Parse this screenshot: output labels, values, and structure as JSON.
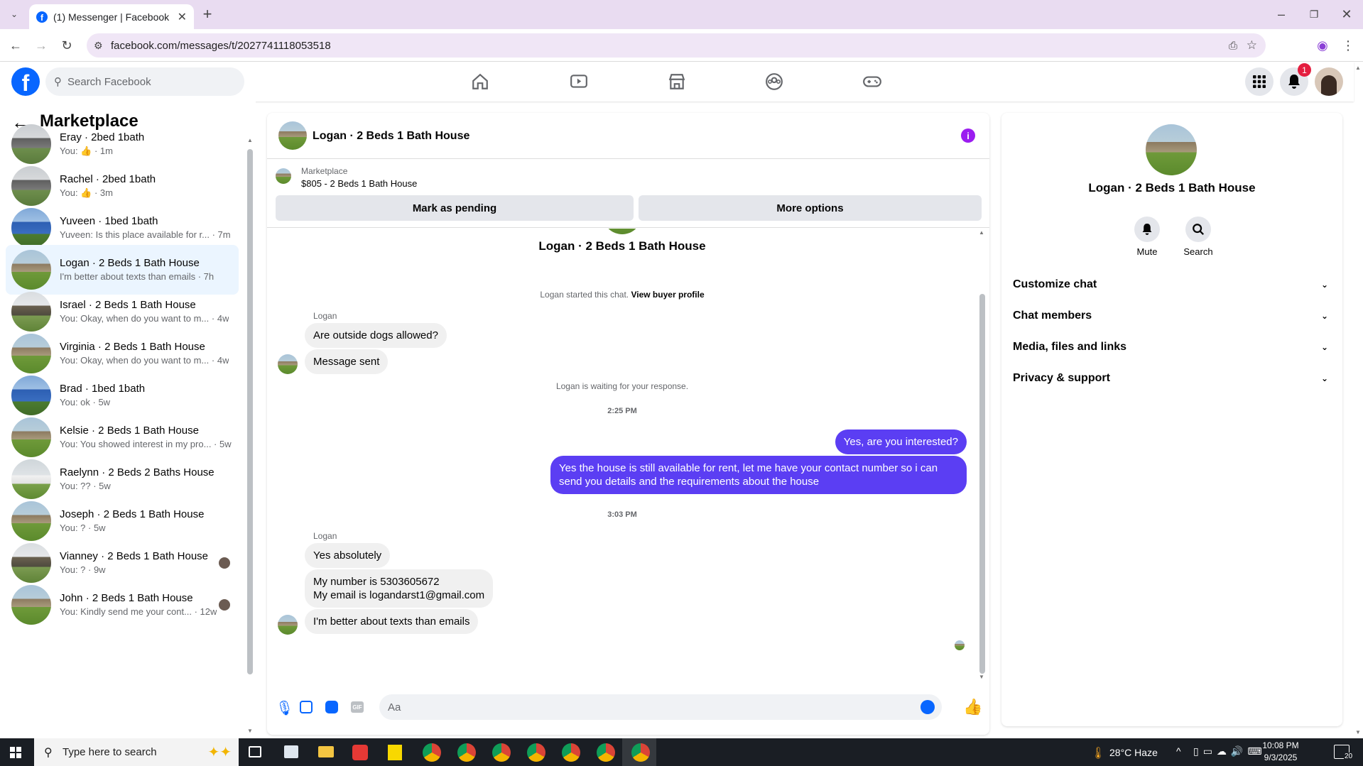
{
  "browser": {
    "tab_title": "(1) Messenger | Facebook",
    "url": "facebook.com/messages/t/2027741118053518"
  },
  "fb": {
    "search_placeholder": "Search Facebook",
    "notification_count": "1"
  },
  "sidebar": {
    "title": "Marketplace",
    "conversations": [
      {
        "name": "Eray · 2bed 1bath",
        "preview": "You: 👍 · 1m"
      },
      {
        "name": "Rachel · 2bed 1bath",
        "preview": "You: 👍 · 3m"
      },
      {
        "name": "Yuveen · 1bed 1bath",
        "preview": "Yuveen: Is this place available for r... · 7m"
      },
      {
        "name": "Logan · 2 Beds 1 Bath House",
        "preview": "I'm better about texts than emails · 7h"
      },
      {
        "name": "Israel · 2 Beds 1 Bath House",
        "preview": "You: Okay, when do you want to m... · 4w"
      },
      {
        "name": "Virginia · 2 Beds 1 Bath House",
        "preview": "You: Okay, when do you want to m... · 4w"
      },
      {
        "name": "Brad · 1bed 1bath",
        "preview": "You: ok · 5w"
      },
      {
        "name": "Kelsie · 2 Beds 1 Bath House",
        "preview": "You: You showed interest in my pro... · 5w"
      },
      {
        "name": "Raelynn · 2 Beds 2 Baths House",
        "preview": "You: ?? · 5w"
      },
      {
        "name": "Joseph · 2 Beds 1 Bath House",
        "preview": "You: ? · 5w"
      },
      {
        "name": "Vianney · 2 Beds 1 Bath House",
        "preview": "You: ? · 9w"
      },
      {
        "name": "John · 2 Beds 1 Bath House",
        "preview": "You: Kindly send me your cont... · 12w"
      }
    ]
  },
  "chat": {
    "header_title": "Logan · 2 Beds 1 Bath House",
    "listing_source": "Marketplace",
    "listing_title": "$805 - 2 Beds 1 Bath House",
    "mark_pending": "Mark as pending",
    "more_options": "More options",
    "profile_name": "Logan · 2 Beds 1 Bath House",
    "started_text": "Logan started this chat.",
    "view_buyer": "View buyer profile",
    "sender1": "Logan",
    "msg1": "Are outside dogs allowed?",
    "msg2": "Message sent",
    "waiting": "Logan is waiting for your response.",
    "time1": "2:25 PM",
    "mine1": "Yes, are you interested?",
    "mine2": "Yes the house is still available for rent, let me have your contact number so i can send you details and the requirements about the house",
    "time2": "3:03 PM",
    "sender2": "Logan",
    "msg3": "Yes absolutely",
    "msg4a": "My number is 5303605672",
    "msg4b": "My email is logandarst1@gmail.com",
    "msg5": "I'm better about texts than emails",
    "composer_placeholder": "Aa"
  },
  "info": {
    "name": "Logan · 2 Beds 1 Bath House",
    "mute": "Mute",
    "search": "Search",
    "sections": [
      "Customize chat",
      "Chat members",
      "Media, files and links",
      "Privacy & support"
    ]
  },
  "taskbar": {
    "search_placeholder": "Type here to search",
    "weather": "28°C  Haze",
    "time": "10:08 PM",
    "date": "9/3/2025",
    "notif": "20"
  },
  "colors": {
    "fb_blue": "#0866ff",
    "messenger_purple": "#5b3ef3",
    "accent_purple": "#9b1cf0"
  }
}
